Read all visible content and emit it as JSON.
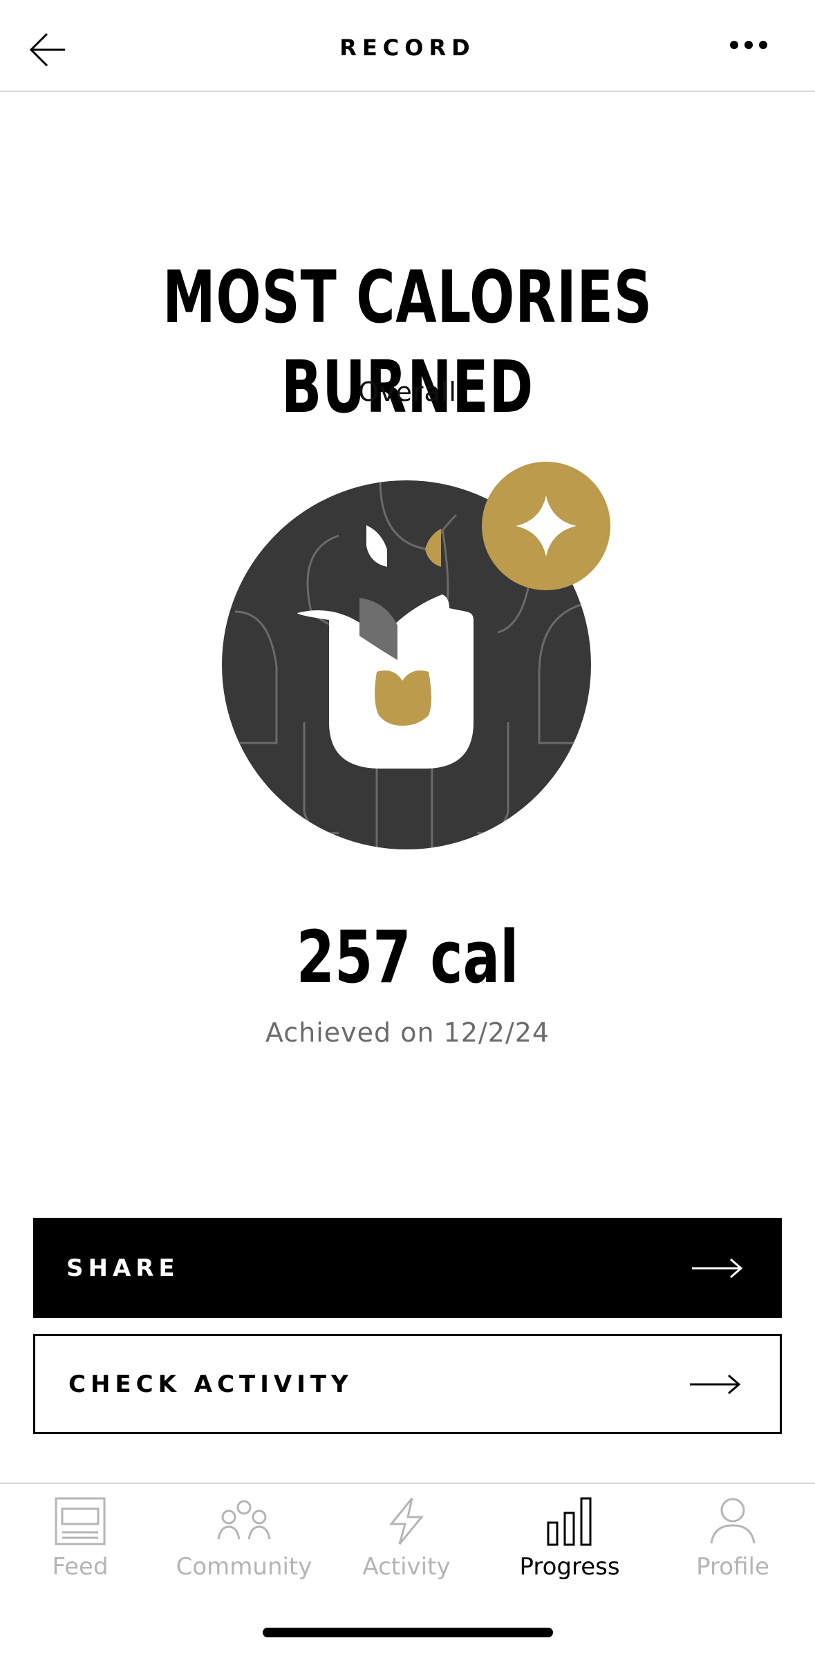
{
  "header": {
    "title": "RECORD"
  },
  "achievement": {
    "title": "MOST CALORIES BURNED",
    "subtitle": "Overall",
    "value": "257 cal",
    "date": "Achieved on 12/2/24"
  },
  "buttons": {
    "share": "SHARE",
    "check_activity": "CHECK ACTIVITY"
  },
  "tabbar": {
    "items": [
      {
        "label": "Feed",
        "icon": "feed-icon",
        "active": false
      },
      {
        "label": "Community",
        "icon": "community-icon",
        "active": false
      },
      {
        "label": "Activity",
        "icon": "activity-icon",
        "active": false
      },
      {
        "label": "Progress",
        "icon": "progress-icon",
        "active": true
      },
      {
        "label": "Profile",
        "icon": "profile-icon",
        "active": false
      }
    ]
  },
  "colors": {
    "gold": "#bd9b4d",
    "badge_dark": "#383838",
    "inactive": "#b5b5b5"
  }
}
